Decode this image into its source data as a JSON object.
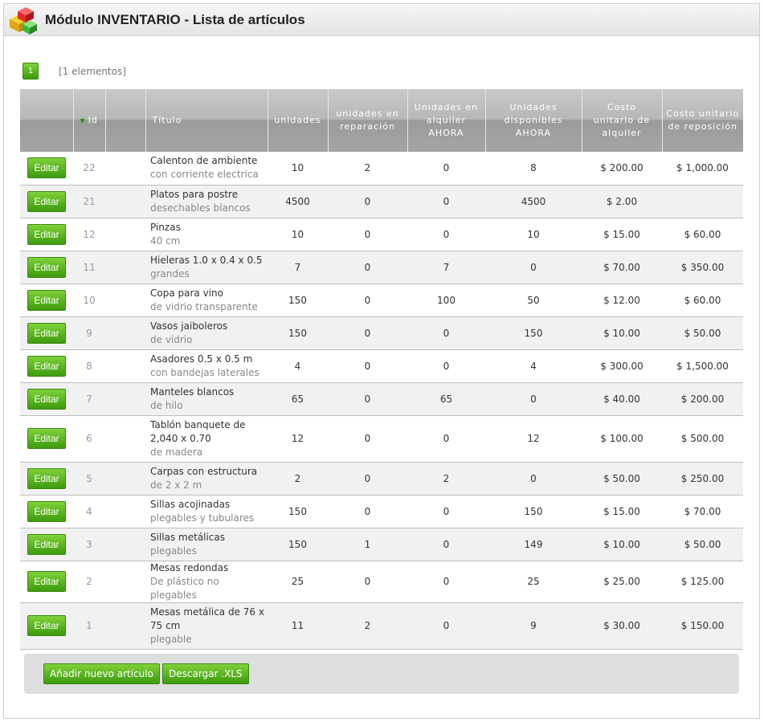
{
  "header": {
    "title": "Módulo INVENTARIO - Lista de artículos",
    "icon": "inventory-boxes-icon"
  },
  "pagination": {
    "current_page": "1",
    "count_text": "[1 elementos]"
  },
  "table": {
    "columns": [
      "",
      "Id",
      "",
      "Título",
      "unidades",
      "unidades en reparación",
      "Unidades en alquiler AHORA",
      "Unidades disponibles AHORA",
      "Costo unitario de alquiler",
      "Costo unitario de reposición"
    ],
    "sorted_column": "Id",
    "sort_direction": "descending",
    "edit_label": "Editar",
    "rows": [
      {
        "id": "22",
        "title": "Calenton de ambiente",
        "subtitle": "con corriente electrica",
        "unidades": "10",
        "reparacion": "2",
        "alquiler": "0",
        "disponibles": "8",
        "costo_alquiler": "$ 200.00",
        "costo_reposicion": "$ 1,000.00"
      },
      {
        "id": "21",
        "title": "Platos para postre",
        "subtitle": "desechables blancos",
        "unidades": "4500",
        "reparacion": "0",
        "alquiler": "0",
        "disponibles": "4500",
        "costo_alquiler": "$ 2.00",
        "costo_reposicion": ""
      },
      {
        "id": "12",
        "title": "Pinzas",
        "subtitle": "40 cm",
        "unidades": "10",
        "reparacion": "0",
        "alquiler": "0",
        "disponibles": "10",
        "costo_alquiler": "$ 15.00",
        "costo_reposicion": "$ 60.00"
      },
      {
        "id": "11",
        "title": "Hieleras 1.0 x 0.4 x 0.5",
        "subtitle": "grandes",
        "unidades": "7",
        "reparacion": "0",
        "alquiler": "7",
        "disponibles": "0",
        "costo_alquiler": "$ 70.00",
        "costo_reposicion": "$ 350.00"
      },
      {
        "id": "10",
        "title": "Copa para vino",
        "subtitle": "de vidrio transparente",
        "unidades": "150",
        "reparacion": "0",
        "alquiler": "100",
        "disponibles": "50",
        "costo_alquiler": "$ 12.00",
        "costo_reposicion": "$ 60.00"
      },
      {
        "id": "9",
        "title": "Vasos jaiboleros",
        "subtitle": "de vidrio",
        "unidades": "150",
        "reparacion": "0",
        "alquiler": "0",
        "disponibles": "150",
        "costo_alquiler": "$ 10.00",
        "costo_reposicion": "$ 50.00"
      },
      {
        "id": "8",
        "title": "Asadores 0.5 x 0.5 m",
        "subtitle": "con bandejas laterales",
        "unidades": "4",
        "reparacion": "0",
        "alquiler": "0",
        "disponibles": "4",
        "costo_alquiler": "$ 300.00",
        "costo_reposicion": "$ 1,500.00"
      },
      {
        "id": "7",
        "title": "Manteles blancos",
        "subtitle": "de hilo",
        "unidades": "65",
        "reparacion": "0",
        "alquiler": "65",
        "disponibles": "0",
        "costo_alquiler": "$ 40.00",
        "costo_reposicion": "$ 200.00"
      },
      {
        "id": "6",
        "title": "Tablón banquete de 2,040 x 0.70",
        "subtitle": "de madera",
        "unidades": "12",
        "reparacion": "0",
        "alquiler": "0",
        "disponibles": "12",
        "costo_alquiler": "$ 100.00",
        "costo_reposicion": "$ 500.00"
      },
      {
        "id": "5",
        "title": "Carpas con estructura",
        "subtitle": "de 2 x 2 m",
        "unidades": "2",
        "reparacion": "0",
        "alquiler": "2",
        "disponibles": "0",
        "costo_alquiler": "$ 50.00",
        "costo_reposicion": "$ 250.00"
      },
      {
        "id": "4",
        "title": "Sillas acojinadas",
        "subtitle": "plegables y tubulares",
        "unidades": "150",
        "reparacion": "0",
        "alquiler": "0",
        "disponibles": "150",
        "costo_alquiler": "$ 15.00",
        "costo_reposicion": "$ 70.00"
      },
      {
        "id": "3",
        "title": "Sillas metálicas",
        "subtitle": "plegables",
        "unidades": "150",
        "reparacion": "1",
        "alquiler": "0",
        "disponibles": "149",
        "costo_alquiler": "$ 10.00",
        "costo_reposicion": "$ 50.00"
      },
      {
        "id": "2",
        "title": "Mesas redondas",
        "subtitle": "De plástico no plegables",
        "unidades": "25",
        "reparacion": "0",
        "alquiler": "0",
        "disponibles": "25",
        "costo_alquiler": "$ 25.00",
        "costo_reposicion": "$ 125.00"
      },
      {
        "id": "1",
        "title": "Mesas metálica de 76 x 75 cm",
        "subtitle": "plegable",
        "unidades": "11",
        "reparacion": "2",
        "alquiler": "0",
        "disponibles": "9",
        "costo_alquiler": "$ 30.00",
        "costo_reposicion": "$ 150.00"
      }
    ]
  },
  "footer": {
    "add_button": "Añadir nuevo artículo",
    "download_button": "Descargar .XLS"
  },
  "colors": {
    "accent_green": "#4caf1a",
    "header_gray": "#a8a8a8",
    "row_alt": "#f1f1f1"
  }
}
